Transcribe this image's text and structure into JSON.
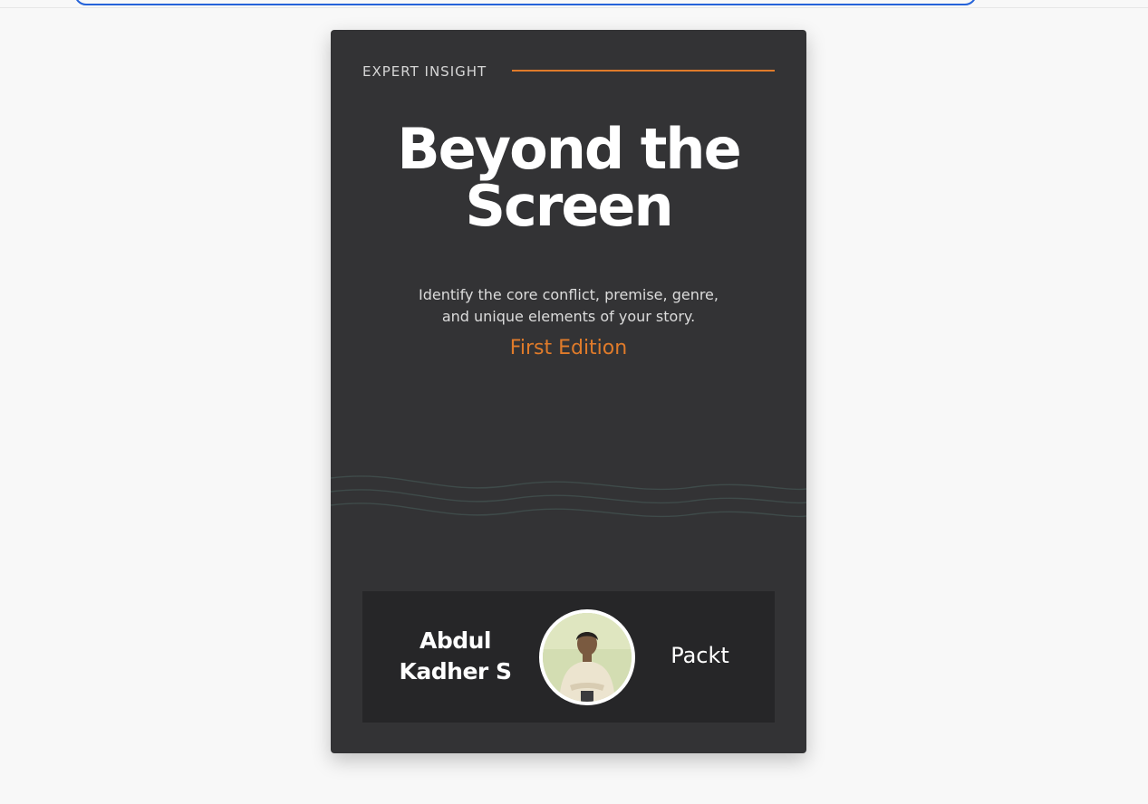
{
  "cover": {
    "series_label": "EXPERT INSIGHT",
    "title_line1": "Beyond the",
    "title_line2": "Screen",
    "subtitle_line1": "Identify the core conflict, premise, genre,",
    "subtitle_line2": "and unique elements of your story.",
    "edition": "First Edition",
    "author_line1": "Abdul",
    "author_line2": "Kadher S",
    "publisher": "Packt"
  },
  "colors": {
    "page_background": "#f8f8f8",
    "cover_background": "#333335",
    "accent": "#e07b2a",
    "author_panel": "#262628",
    "focus_border": "#2563d9",
    "wave_stroke": "#3f4b4a"
  },
  "icons": {
    "avatar": "author-photo"
  }
}
